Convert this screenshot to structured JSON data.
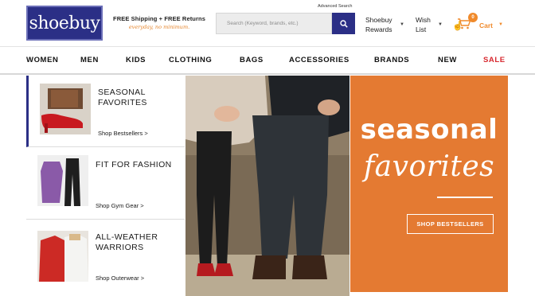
{
  "header": {
    "logo_text": "shoebuy",
    "promo_line1": "FREE Shipping + FREE Returns",
    "promo_line2": "everyday, no minimum.",
    "advanced_search": "Advanced Search",
    "search_placeholder": "Search (Keyword, brands, etc.)",
    "rewards_line1": "Shoebuy",
    "rewards_line2": "Rewards",
    "wish_line1": "Wish",
    "wish_line2": "List",
    "cart_count": "0",
    "cart_label": "Cart"
  },
  "nav": [
    "WOMEN",
    "MEN",
    "KIDS",
    "CLOTHING",
    "BAGS",
    "ACCESSORIES",
    "BRANDS",
    "NEW",
    "SALE"
  ],
  "side_cards": [
    {
      "title_line1": "SEASONAL",
      "title_line2": "FAVORITES",
      "link": "Shop Bestsellers >"
    },
    {
      "title_line1": "FIT FOR FASHION",
      "title_line2": "",
      "link": "Shop Gym Gear >"
    },
    {
      "title_line1": "ALL-WEATHER",
      "title_line2": "WARRIORS",
      "link": "Shop Outerwear >"
    }
  ],
  "hero": {
    "headline1": "seasonal",
    "headline2": "favorites",
    "button": "SHOP BESTSELLERS"
  },
  "colors": {
    "brand": "#2b2f86",
    "accent": "#e47a32",
    "sale": "#d7282f"
  }
}
